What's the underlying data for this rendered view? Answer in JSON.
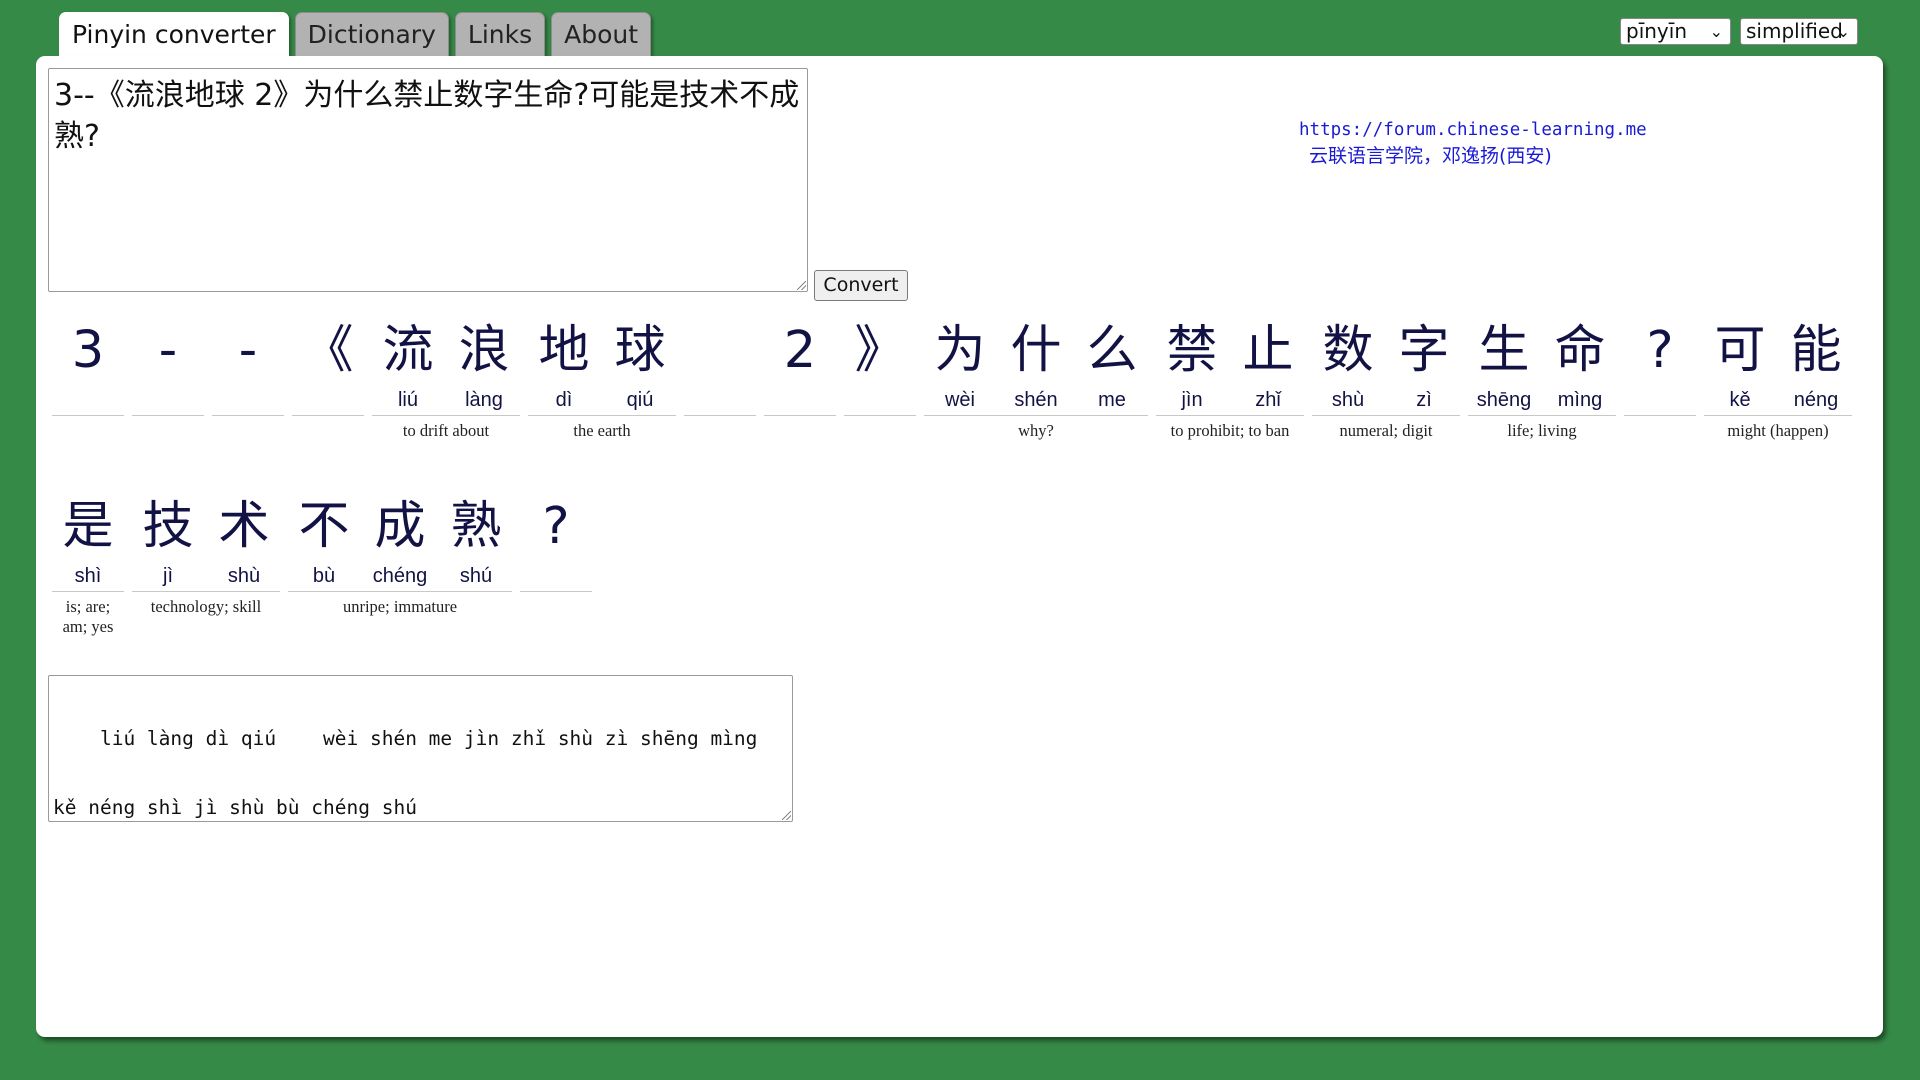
{
  "tabs": [
    {
      "label": "Pinyin converter",
      "active": true
    },
    {
      "label": "Dictionary"
    },
    {
      "label": "Links"
    },
    {
      "label": "About"
    }
  ],
  "selects": {
    "mode": "pīnyīn",
    "script": "simplified"
  },
  "input_text": "3--《流浪地球 2》为什么禁止数字生命?可能是技术不成熟?",
  "convert_label": "Convert",
  "credit": {
    "url": "https://forum.chinese-learning.me",
    "org": "云联语言学院，邓逸扬(西安)"
  },
  "rows": [
    [
      {
        "chars": [
          {
            "han": "3",
            "py": ""
          }
        ],
        "def": ""
      },
      {
        "chars": [
          {
            "han": "-",
            "py": ""
          }
        ],
        "def": ""
      },
      {
        "chars": [
          {
            "han": "-",
            "py": ""
          }
        ],
        "def": ""
      },
      {
        "chars": [
          {
            "han": "《",
            "py": ""
          }
        ],
        "def": ""
      },
      {
        "chars": [
          {
            "han": "流",
            "py": "liú"
          },
          {
            "han": "浪",
            "py": "làng"
          }
        ],
        "def": "to drift about"
      },
      {
        "chars": [
          {
            "han": "地",
            "py": "dì"
          },
          {
            "han": "球",
            "py": "qiú"
          }
        ],
        "def": "the earth"
      },
      {
        "chars": [
          {
            "han": " ",
            "py": ""
          }
        ],
        "def": ""
      },
      {
        "chars": [
          {
            "han": "2",
            "py": ""
          }
        ],
        "def": ""
      },
      {
        "chars": [
          {
            "han": "》",
            "py": ""
          }
        ],
        "def": ""
      },
      {
        "chars": [
          {
            "han": "为",
            "py": "wèi"
          },
          {
            "han": "什",
            "py": "shén"
          },
          {
            "han": "么",
            "py": "me"
          }
        ],
        "def": "why?"
      },
      {
        "chars": [
          {
            "han": "禁",
            "py": "jìn"
          },
          {
            "han": "止",
            "py": "zhǐ"
          }
        ],
        "def": "to prohibit; to ban"
      },
      {
        "chars": [
          {
            "han": "数",
            "py": "shù"
          },
          {
            "han": "字",
            "py": "zì"
          }
        ],
        "def": "numeral; digit"
      },
      {
        "chars": [
          {
            "han": "生",
            "py": "shēng"
          },
          {
            "han": "命",
            "py": "mìng"
          }
        ],
        "def": "life; living"
      },
      {
        "chars": [
          {
            "han": "?",
            "py": ""
          }
        ],
        "def": ""
      },
      {
        "chars": [
          {
            "han": "可",
            "py": "kě"
          },
          {
            "han": "能",
            "py": "néng"
          }
        ],
        "def": "might (happen)"
      }
    ],
    [
      {
        "chars": [
          {
            "han": "是",
            "py": "shì"
          }
        ],
        "def": "is; are; am; yes"
      },
      {
        "chars": [
          {
            "han": "技",
            "py": "jì"
          },
          {
            "han": "术",
            "py": "shù"
          }
        ],
        "def": "technology; skill"
      },
      {
        "chars": [
          {
            "han": "不",
            "py": "bù"
          },
          {
            "han": "成",
            "py": "chéng"
          },
          {
            "han": "熟",
            "py": "shú"
          }
        ],
        "def": "unripe; immature"
      },
      {
        "chars": [
          {
            "han": "?",
            "py": ""
          }
        ],
        "def": ""
      }
    ]
  ],
  "output_lines": [
    "    liú làng dì qiú    wèi shén me jìn zhǐ shù zì shēng mìng",
    "kě néng shì jì shù bù chéng shú"
  ]
}
